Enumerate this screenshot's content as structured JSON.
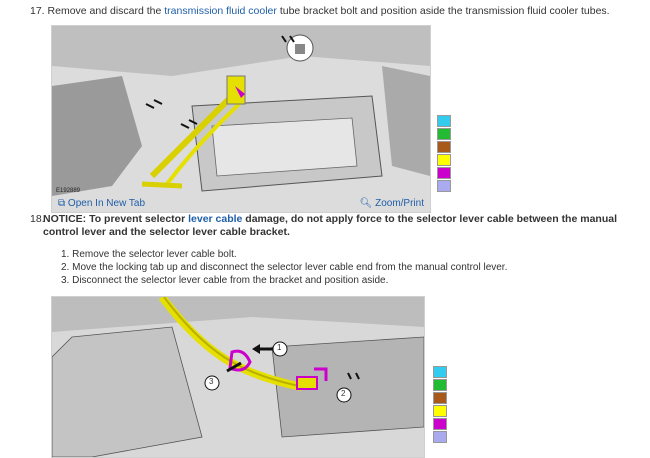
{
  "step17": {
    "number": "17.",
    "prefix": "Remove and discard the ",
    "link": "transmission fluid cooler",
    "suffix": " tube bracket bolt and position aside the transmission fluid cooler tubes."
  },
  "figure1": {
    "code": "E192889",
    "open_tab_label": "Open In New Tab",
    "zoom_label": "Zoom/Print"
  },
  "step18": {
    "number": "18.",
    "notice_prefix": "NOTICE: To prevent selector ",
    "link": "lever cable",
    "notice_suffix": " damage, do not apply force to the selector lever cable between the manual control lever and the selector lever cable bracket."
  },
  "substeps": [
    "1. Remove the selector lever cable bolt.",
    "2. Move the locking tab up and disconnect the selector lever cable end from the manual control lever.",
    "3. Disconnect the selector lever cable from the bracket and position aside."
  ],
  "figure2": {
    "callouts": [
      "1",
      "2",
      "3"
    ]
  },
  "palette_colors": [
    "#33ccee",
    "#22bb33",
    "#a85a1a",
    "#ffff00",
    "#cc00cc",
    "#aaaaee"
  ]
}
